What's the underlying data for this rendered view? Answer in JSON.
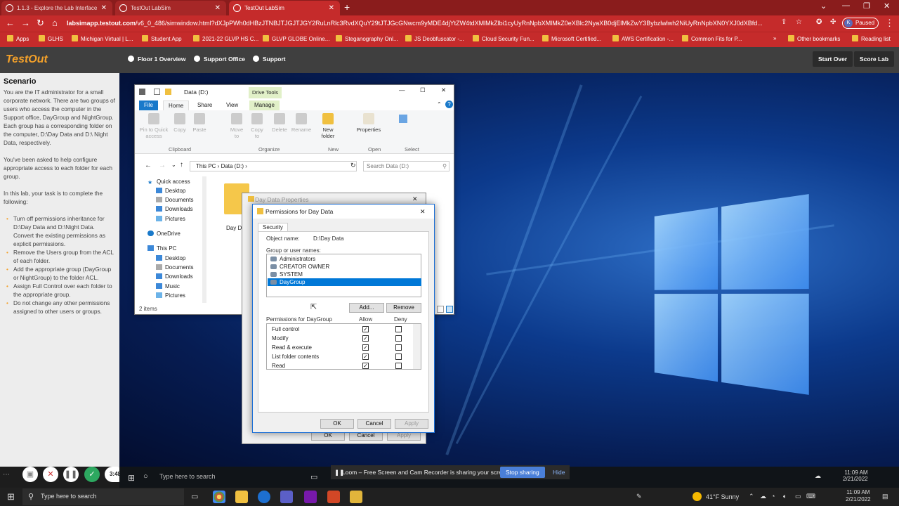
{
  "browser": {
    "tabs": [
      {
        "label": "1.1.3 - Explore the Lab Interface"
      },
      {
        "label": "TestOut LabSim"
      },
      {
        "label": "TestOut LabSim"
      }
    ],
    "url_host": "labsimapp.testout.com",
    "url_path": "/v6_0_486/simwindow.html?dXJpPWh0dHBzJTNBJTJGJTJGY2RuLnRlc3RvdXQuY29tJTJGcGNwcm9yMDE4djYtZW4tdXMlMkZlbi1cyUyRnNpbXMlMkZ0eXBlc2NyaXB0djElMkZwY3Bybzlwlwh2NiUyRnNpbXN0YXJ0dXBfd...",
    "paused_label": "Paused",
    "avatar_letter": "K",
    "bookmarks": [
      "Apps",
      "GLHS",
      "Michigan Virtual | L...",
      "Student App",
      "2021-22 GLVP HS C...",
      "GLVP GLOBE Online...",
      "Steganography Onl...",
      "JS Deobfuscator -...",
      "Cloud Security Fun...",
      "Microsoft Certified...",
      "AWS Certification -...",
      "Common Fits for P..."
    ],
    "other_bookmarks": "Other bookmarks",
    "reading_list": "Reading list"
  },
  "testout": {
    "logo": "TestOut",
    "nav": [
      "Floor 1 Overview",
      "Support Office",
      "Support"
    ],
    "start_over": "Start Over",
    "score_lab": "Score Lab"
  },
  "scenario": {
    "heading": "Scenario",
    "p1": "You are the IT administrator for a small corporate network. There are two groups of users who access the computer in the Support office, DayGroup and NightGroup. Each group has a corresponding folder on the computer, D:\\Day Data and D:\\ Night Data, respectively.",
    "p2": "You've been asked to help configure appropriate access to each folder for each group.",
    "p3": "In this lab, your task is to complete the following:",
    "tasks": [
      "Turn off permissions inheritance for D:\\Day Data and D:\\Night Data. Convert the existing permissions as explicit permissions.",
      "Remove the Users group from the ACL of each folder.",
      "Add the appropriate group (DayGroup or NightGroup) to the folder ACL.",
      "Assign Full Control over each folder to the appropriate group.",
      "Do not change any other permissions assigned to other users or groups."
    ],
    "timer": "3:48"
  },
  "explorer": {
    "title": "Data (D:)",
    "drive_tools": "Drive Tools",
    "tabs": [
      "File",
      "Home",
      "Share",
      "View",
      "Manage"
    ],
    "tools": [
      "Pin to Quick access",
      "Copy",
      "Paste",
      "Move to",
      "Copy to",
      "Delete",
      "Rename",
      "New folder",
      "Properties"
    ],
    "groups": [
      "Clipboard",
      "Organize",
      "New",
      "Open",
      "Select"
    ],
    "address": [
      "This PC",
      "Data (D:)"
    ],
    "search_placeholder": "Search Data (D:)",
    "nav": [
      "Quick access",
      "Desktop",
      "Documents",
      "Downloads",
      "Pictures",
      "OneDrive",
      "This PC",
      "Desktop",
      "Documents",
      "Downloads",
      "Music",
      "Pictures"
    ],
    "folder_label": "Day D",
    "status": "2 items"
  },
  "properties": {
    "title": "Day Data Properties",
    "ok": "OK",
    "cancel": "Cancel",
    "apply": "Apply"
  },
  "permissions": {
    "title": "Permissions for Day Data",
    "tab": "Security",
    "object_label": "Object name:",
    "object_value": "D:\\Day Data",
    "group_label": "Group or user names:",
    "groups": [
      "Administrators",
      "CREATOR OWNER",
      "SYSTEM",
      "DayGroup"
    ],
    "selected_group": "DayGroup",
    "add": "Add...",
    "remove": "Remove",
    "perm_for": "Permissions for DayGroup",
    "allow": "Allow",
    "deny": "Deny",
    "perms": [
      {
        "name": "Full control",
        "allow": true,
        "deny": false
      },
      {
        "name": "Modify",
        "allow": true,
        "deny": false
      },
      {
        "name": "Read & execute",
        "allow": true,
        "deny": false
      },
      {
        "name": "List folder contents",
        "allow": true,
        "deny": false
      },
      {
        "name": "Read",
        "allow": true,
        "deny": false
      }
    ],
    "ok": "OK",
    "cancel": "Cancel",
    "apply": "Apply"
  },
  "loom": {
    "message": "Loom – Free Screen and Cam Recorder is sharing your screen.",
    "stop": "Stop sharing",
    "hide": "Hide"
  },
  "taskbar": {
    "search": "Type here to search",
    "weather": "41°F  Sunny",
    "time": "11:09 AM",
    "date": "2/21/2022"
  }
}
